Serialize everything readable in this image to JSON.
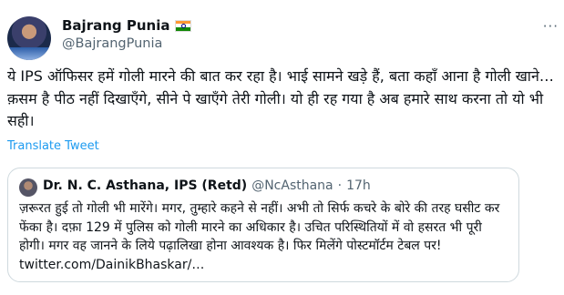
{
  "author": {
    "name": "Bajrang Punia",
    "handle": "@BajrangPunia"
  },
  "tweet": {
    "text": "ये IPS ऑफिसर हमें गोली मारने की बात कर रहा है। भाई सामने खड़े हैं, बता कहाँ आना है गोली खाने… क़सम है पीठ नहीं दिखाएँगे, सीने पे खाएँगे तेरी गोली। यो ही रह गया है अब हमारे साथ करना तो यो भी सही।",
    "translate_label": "Translate Tweet"
  },
  "quoted": {
    "name": "Dr. N. C. Asthana, IPS (Retd)",
    "handle": "@NcAsthana",
    "separator": "·",
    "time": "17h",
    "text": "ज़रूरत हुई तो गोली भी मारेंगे। मगर, तुम्हारे कहने से नहीं। अभी तो सिर्फ कचरे के बोरे की तरह घसीट कर फेंका है। दफ़ा 129 में पुलिस को गोली मारने का अधिकार है। उचित परिस्थितियों में वो हसरत भी पूरी होगी। मगर वह जानने के लिये पढ़ालिखा होना आवश्यक है। फिर मिलेंगे पोस्टमॉर्टम टेबल पर! twitter.com/DainikBhaskar/…"
  },
  "icons": {
    "more": "more-options-icon",
    "flag": "india-flag-icon"
  }
}
